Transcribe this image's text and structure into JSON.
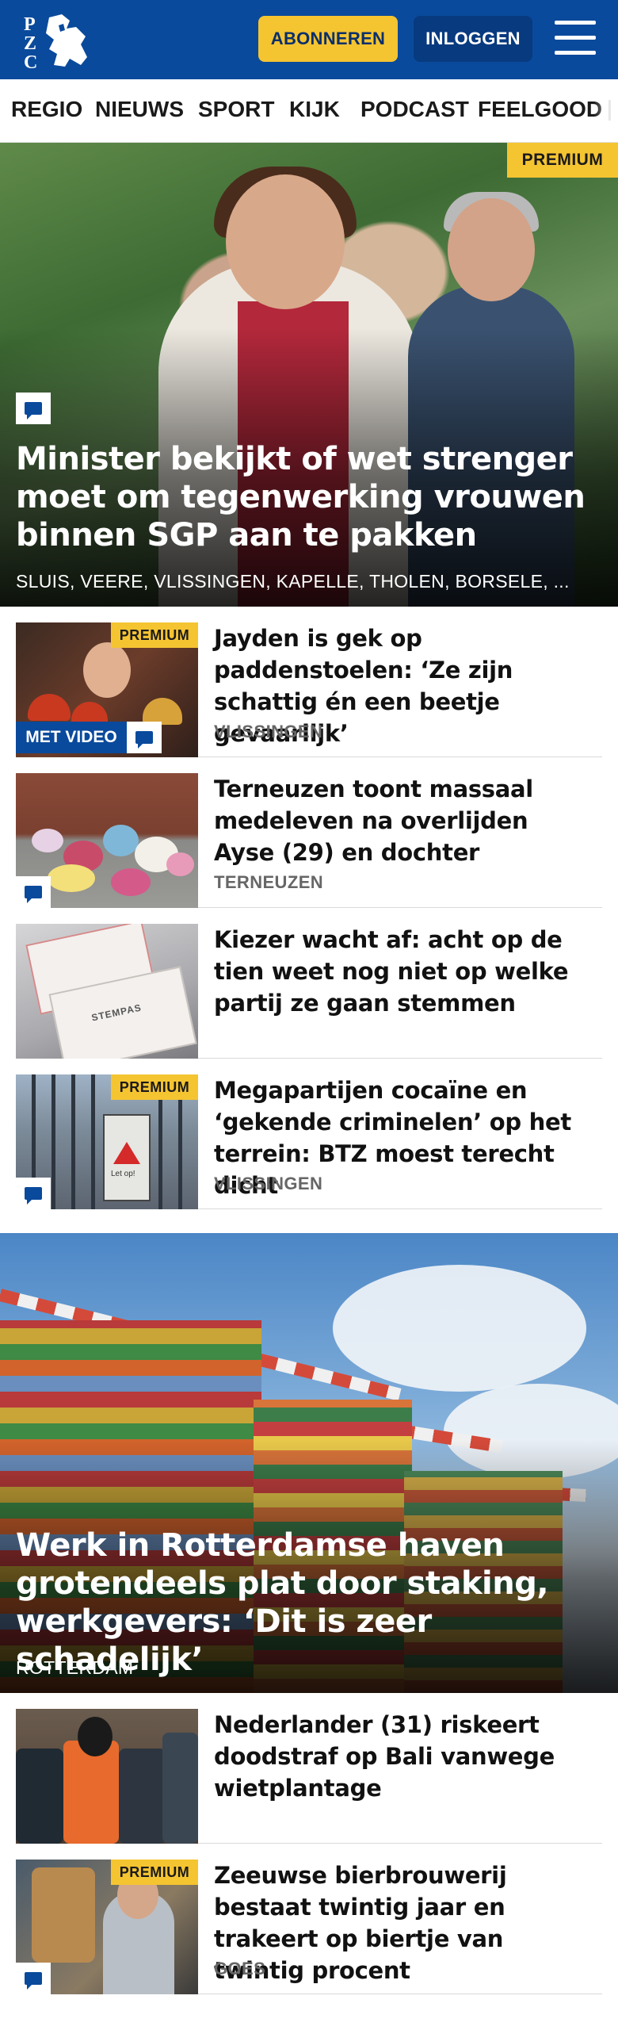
{
  "header": {
    "logo_alt": "PZC",
    "subscribe_label": "ABONNEREN",
    "login_label": "INLOGGEN",
    "menu_icon": "hamburger-icon"
  },
  "nav": {
    "items": [
      {
        "label": "REGIO"
      },
      {
        "label": "NIEUWS"
      },
      {
        "label": "SPORT"
      },
      {
        "label": "KIJK"
      },
      {
        "label": "PODCAST"
      },
      {
        "label": "FEELGOOD"
      }
    ]
  },
  "badges": {
    "premium": "PREMIUM",
    "video": "MET VIDEO"
  },
  "hero": {
    "title": "Minister bekijkt of wet strenger moet om tegenwerking vrouwen binnen SGP aan te pakken",
    "locations": "SLUIS, VEERE, VLISSINGEN, KAPELLE, THOLEN, BORSELE, ..."
  },
  "articles": [
    {
      "title": "Jayden is gek op paddenstoelen: ‘Ze zijn schattig én een beetje gevaarlijk’",
      "location": "VLISSINGEN"
    },
    {
      "title": "Terneuzen toont massaal medeleven na overlijden Ayse (29) en dochter",
      "location": "TERNEUZEN"
    },
    {
      "title": "Kiezer wacht af: acht op de tien weet nog niet op welke partij ze gaan stemmen",
      "location": ""
    },
    {
      "title": "Megapartijen cocaïne en ‘gekende criminelen’ op het terrein: BTZ moest terecht dicht",
      "location": "VLISSINGEN"
    }
  ],
  "hero2": {
    "title": "Werk in Rotterdamse haven groten­deels plat door staking, werkgevers: ‘Dit is zeer schadelijk’",
    "location": "ROTTERDAM"
  },
  "articles2": [
    {
      "title": "Nederlander (31) riskeert doodstraf op Bali vanwege wietplantage",
      "location": ""
    },
    {
      "title": "Zeeuwse bierbrouwerij bestaat twintig jaar en trakeert op biertje van twintig procent",
      "location": "GOES"
    }
  ],
  "thumb_text": {
    "ballot": "STEMPAS",
    "sign": "Let op!"
  },
  "colors": {
    "brand_blue": "#0a4a9c",
    "premium_yellow": "#f5c431",
    "location_gray": "#666666"
  }
}
